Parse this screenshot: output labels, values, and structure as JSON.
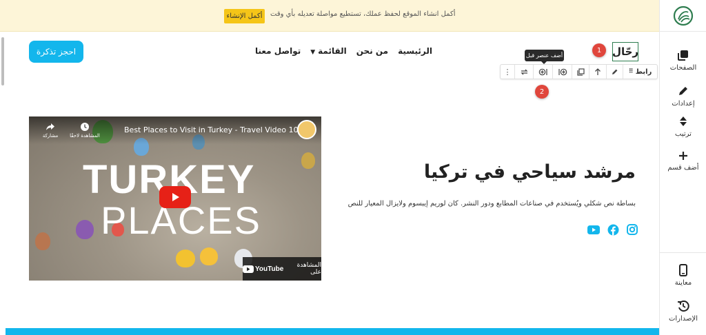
{
  "banner": {
    "message": "أكمل انشاء الموقع لحفظ عملك، تستطيع مواصلة تعديله بأي وقت",
    "button_label": "أكمل الإنشاء"
  },
  "sidebar": {
    "items": [
      {
        "label": "الصفحات",
        "icon": "pages-icon"
      },
      {
        "label": "إعدادات",
        "icon": "pencil-icon"
      },
      {
        "label": "ترتيب",
        "icon": "sort-icon"
      },
      {
        "label": "أضف قسم",
        "icon": "plus-icon"
      }
    ],
    "bottom_items": [
      {
        "label": "معاينة",
        "icon": "mobile-preview-icon"
      },
      {
        "label": "الإصدارات",
        "icon": "history-icon"
      }
    ]
  },
  "site": {
    "brand": "رحّال",
    "cta_label": "احجز تذكرة",
    "nav": [
      {
        "label": "الرئيسية"
      },
      {
        "label": "من نحن"
      },
      {
        "label": "القائمة",
        "dropdown": true
      },
      {
        "label": "تواصل معنا"
      }
    ]
  },
  "toolbar": {
    "label": "رابط",
    "tooltip": "أضف عنصر قبل",
    "icons": [
      "drag-handle-icon",
      "pencil-icon",
      "arrow-up-icon",
      "copy-icon",
      "add-after-icon",
      "add-before-icon",
      "replace-icon",
      "more-icon"
    ]
  },
  "badges": [
    "1",
    "2"
  ],
  "video": {
    "title": "Best Places to Visit in Turkey - Travel Video 10",
    "watch_later": "المشاهدة لاحقًا",
    "share": "مشاركة",
    "headline_1": "TURKEY",
    "headline_2": "PLACES",
    "watch_on": "المشاهدة على",
    "youtube": "YouTube"
  },
  "hero": {
    "title": "مرشد سياحي في تركيا",
    "description": "بساطة نص شكلي ويُستخدم في صناعات المطابع ودور النشر. كان لوريم إيبسوم ولايزال المعيار للنص"
  },
  "socials": [
    "youtube-icon",
    "facebook-icon",
    "instagram-icon"
  ],
  "colors": {
    "accent": "#13b6ec",
    "banner_bg": "#fdf5d8",
    "banner_button": "#f5c518",
    "badge": "#e0463c",
    "youtube_red": "#e62117",
    "facebook_blue": "#1877f2"
  }
}
